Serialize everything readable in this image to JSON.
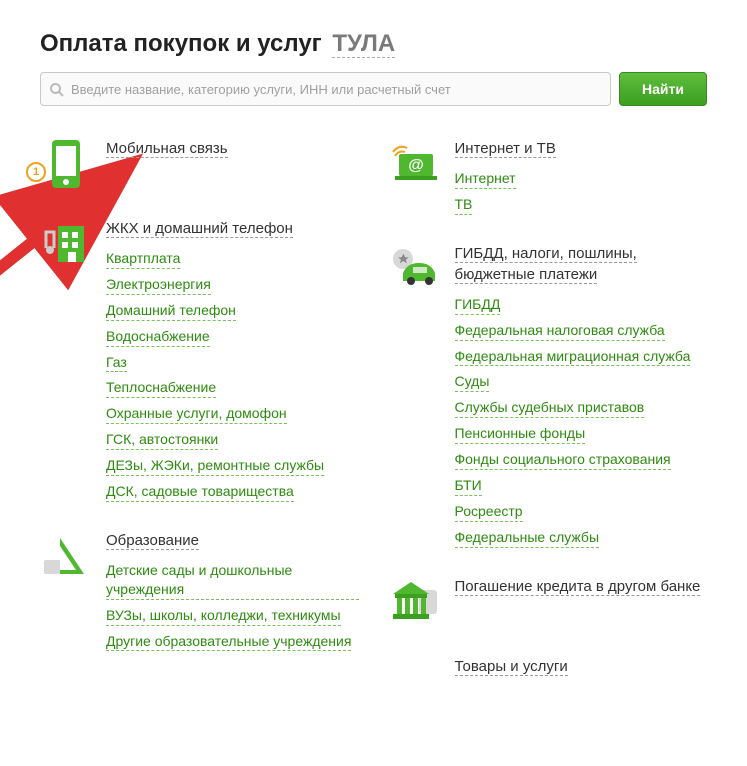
{
  "title": "Оплата покупок и услуг",
  "region": "ТУЛА",
  "search": {
    "placeholder": "Введите название, категорию услуги, ИНН или расчетный счет",
    "button": "Найти"
  },
  "badge_number": "1",
  "left": [
    {
      "icon": "phone",
      "title": "Мобильная связь",
      "links": [],
      "badge": true
    },
    {
      "icon": "building",
      "title": "ЖКХ и домашний телефон",
      "links": [
        "Квартплата",
        "Электроэнергия",
        "Домашний телефон",
        "Водоснабжение",
        "Газ",
        "Теплоснабжение",
        "Охранные услуги, домофон",
        "ГСК, автостоянки",
        "ДЕЗы, ЖЭКи, ремонтные службы",
        "ДСК, садовые товарищества"
      ]
    },
    {
      "icon": "ruler",
      "title": "Образование",
      "links": [
        "Детские сады и дошкольные учреждения",
        "ВУЗы, школы, колледжи, техникумы",
        "Другие образовательные учреждения"
      ]
    }
  ],
  "right": [
    {
      "icon": "internet",
      "title": "Интернет и ТВ",
      "links": [
        "Интернет",
        "ТВ"
      ]
    },
    {
      "icon": "car",
      "title": "ГИБДД, налоги, пошлины, бюджетные платежи",
      "links": [
        "ГИБДД",
        "Федеральная налоговая служба",
        "Федеральная миграционная служба",
        "Суды",
        "Службы судебных приставов",
        "Пенсионные фонды",
        "Фонды социального страхования",
        "БТИ",
        "Росреестр",
        "Федеральные службы"
      ]
    },
    {
      "icon": "bank",
      "title": "Погашение кредита в другом банке",
      "links": []
    },
    {
      "icon": "cart",
      "title": "Товары и услуги",
      "links": []
    }
  ]
}
